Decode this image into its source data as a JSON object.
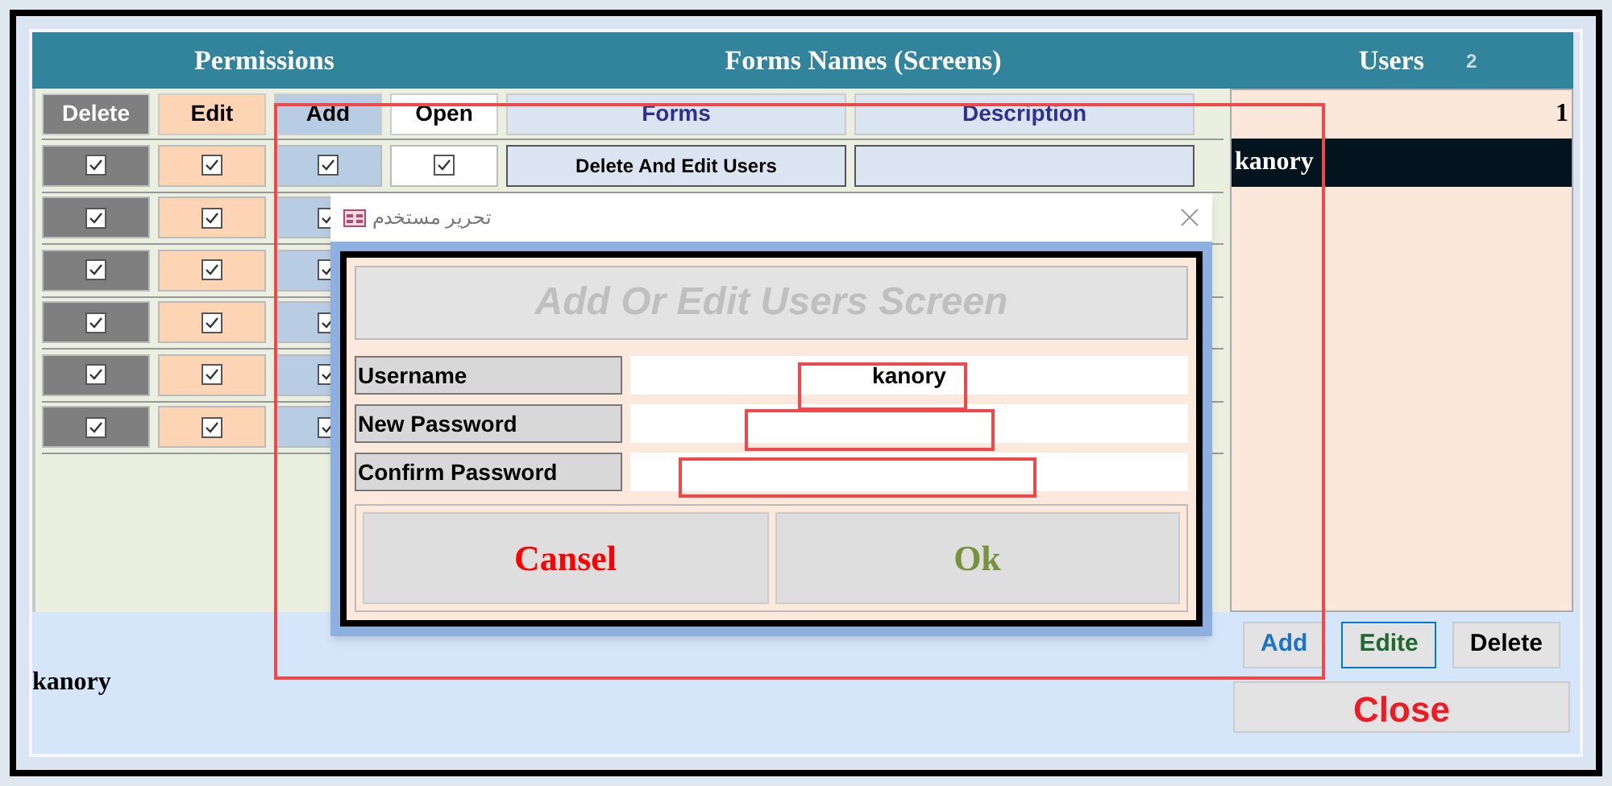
{
  "header": {
    "permissions": "Permissions",
    "forms": "Forms Names (Screens)",
    "users": "Users",
    "users_count": "2"
  },
  "columns": [
    "Delete",
    "Edit",
    "Add",
    "Open",
    "Forms",
    "Description"
  ],
  "rows": [
    {
      "delete": true,
      "edit": true,
      "add": true,
      "open": true,
      "form": "Delete And Edit Users"
    },
    {
      "delete": true,
      "edit": true,
      "add": true
    },
    {
      "delete": true,
      "edit": true,
      "add": true
    },
    {
      "delete": true,
      "edit": true,
      "add": true
    },
    {
      "delete": true,
      "edit": true,
      "add": true
    },
    {
      "delete": true,
      "edit": true,
      "add": true
    }
  ],
  "users": {
    "record": "1",
    "items": [
      {
        "name": "kanory",
        "selected": true
      }
    ]
  },
  "current_user": "kanory",
  "user_buttons": [
    "Add",
    "Edite",
    "Delete"
  ],
  "close_button": "Close",
  "dialog": {
    "title": "تحرير مستخدم",
    "heading": "Add Or Edit Users Screen",
    "fields": [
      {
        "label": "Username",
        "value": "kanory"
      },
      {
        "label": "New Password"
      },
      {
        "label": "Confirm Password"
      }
    ],
    "cancel": "Cansel",
    "ok": "Ok"
  }
}
